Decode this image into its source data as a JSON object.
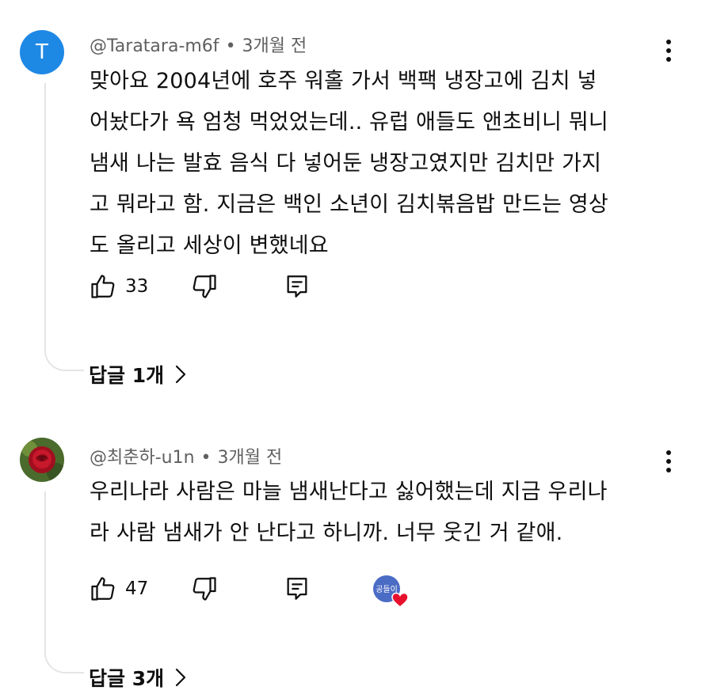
{
  "comments": [
    {
      "avatar_letter": "T",
      "avatar_color": "#1e88e5",
      "author": "@Taratara-m6f",
      "separator": "•",
      "time": "3개월 전",
      "lines": [
        "맞아요 2004년에 호주 워홀 가서 백팩 냉장고에 김치 넣",
        "어놨다가 욕 엄청 먹었었는데.. 유럽 애들도 앤초비니 뭐니",
        "냄새 나는 발효 음식 다 넣어둔 냉장고였지만 김치만 가지",
        "고 뭐라고 함. 지금은 백인 소년이 김치볶음밥 만드는 영상",
        "도 올리고 세상이 변했네요"
      ],
      "likes": "33",
      "replies_label": "답글 1개"
    },
    {
      "avatar_icon": "red-rose-avatar",
      "author": "@최춘하-u1n",
      "separator": "•",
      "time": "3개월 전",
      "lines": [
        "우리나라 사람은 마늘 냄새난다고 싫어했는데 지금 우리나",
        "라 사람 냄새가 안 난다고 하니까. 너무 웃긴 거 같애."
      ],
      "likes": "47",
      "creator_heart_text": "공들이",
      "replies_label": "답글 3개"
    }
  ],
  "icons": {
    "like": "thumbs-up-icon",
    "dislike": "thumbs-down-icon",
    "reply": "reply-comment-icon",
    "more": "more-vertical-icon",
    "chevron": "chevron-right-icon"
  },
  "colors": {
    "text_primary": "#0f0f0f",
    "text_secondary": "#606060",
    "thread_line": "#e5e5e5",
    "heart": "#e8112d"
  }
}
